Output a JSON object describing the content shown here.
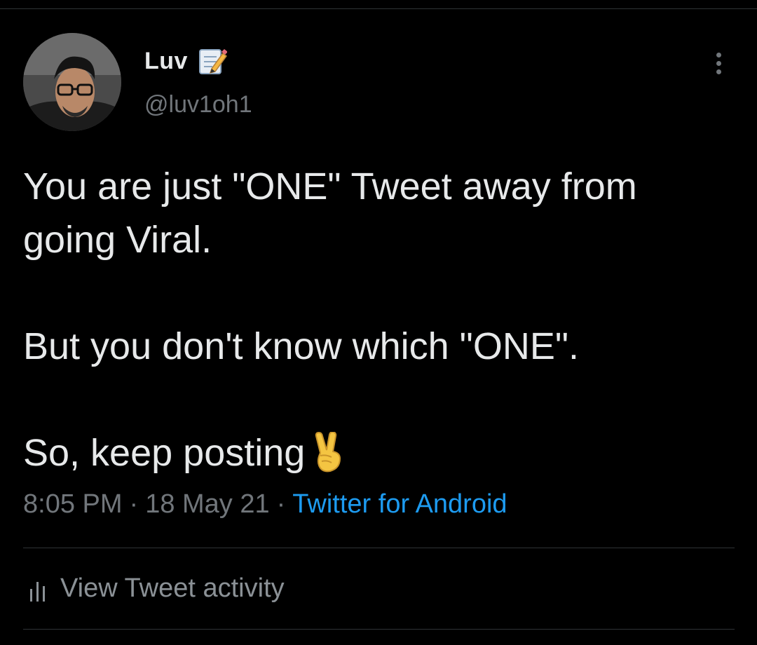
{
  "user": {
    "display_name": "Luv",
    "handle": "@luv1oh1",
    "name_emoji_icon": "memo-pencil-icon",
    "avatar": "profile-photo"
  },
  "tweet": {
    "lines": [
      "You are just \"ONE\" Tweet away from",
      "going Viral.",
      "",
      "But you don't know which \"ONE\".",
      "",
      "So, keep posting"
    ],
    "trailing_emoji_icon": "victory-hand-icon",
    "time": "8:05 PM",
    "date": "18 May 21",
    "separator": "·",
    "source": "Twitter for Android"
  },
  "activity": {
    "label": "View Tweet activity",
    "icon": "bar-chart-icon"
  },
  "colors": {
    "background": "#000000",
    "primary_text": "#e7e9ea",
    "secondary_text": "#71767b",
    "link": "#1d9bf0",
    "divider": "#2f3336"
  }
}
